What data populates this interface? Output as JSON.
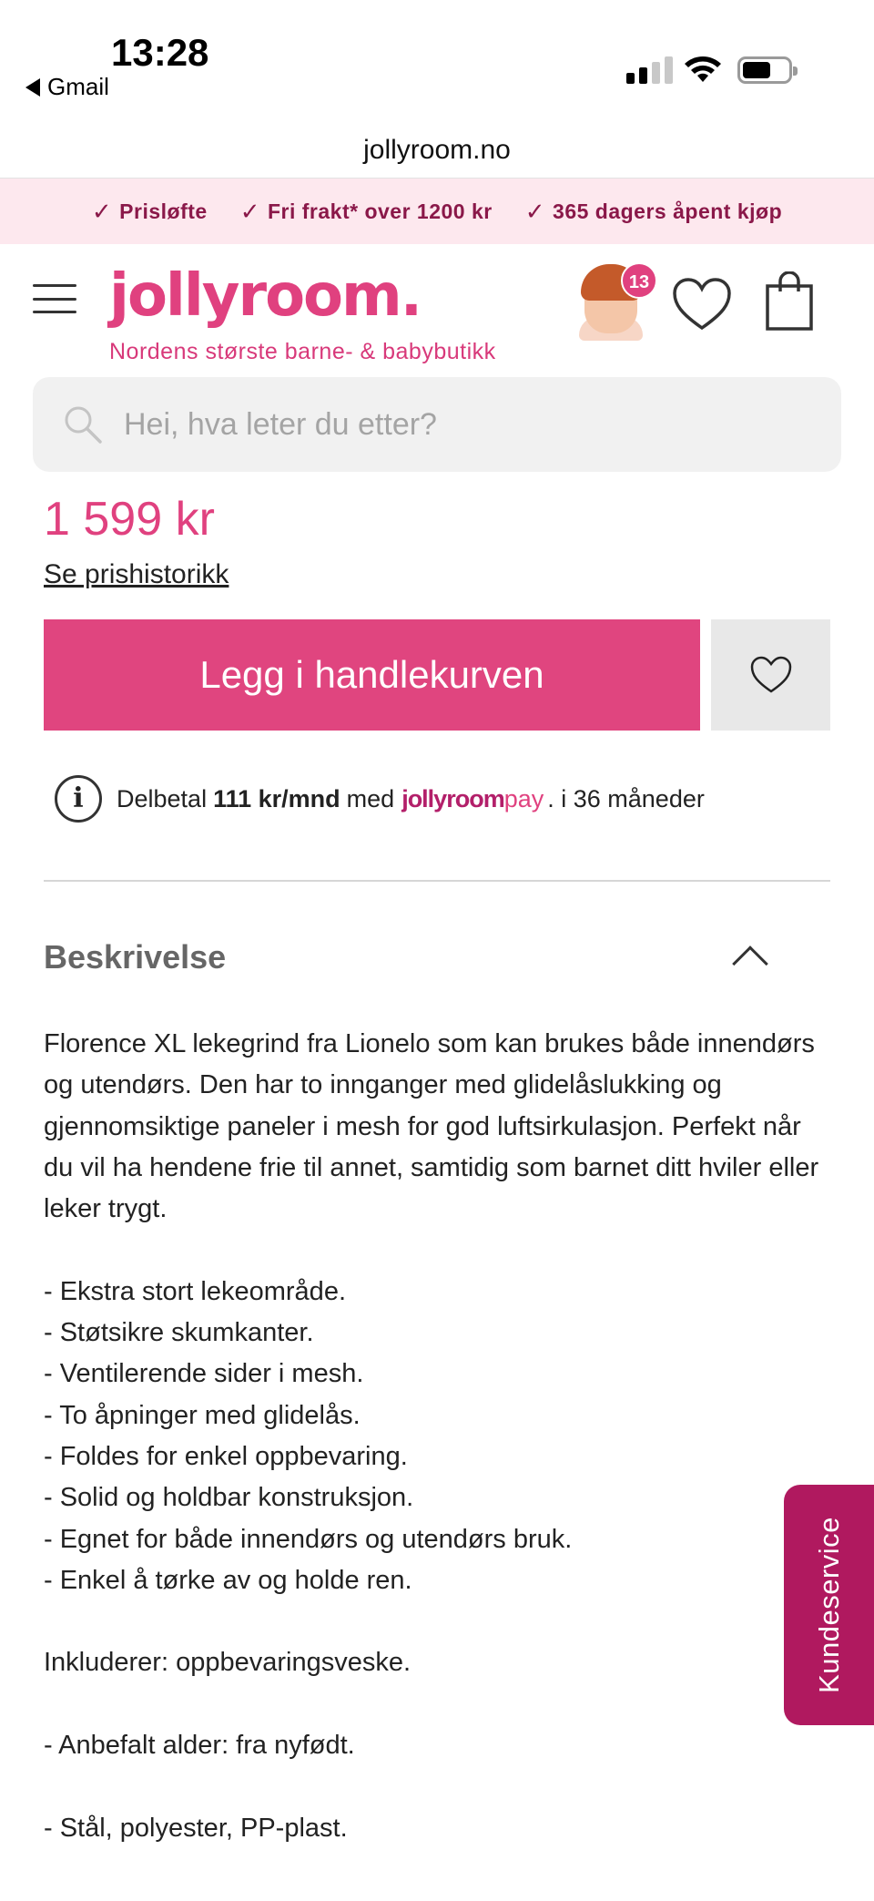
{
  "status_bar": {
    "time": "13:28",
    "back_app": "Gmail"
  },
  "browser": {
    "url": "jollyroom.no"
  },
  "usp": [
    {
      "icon": "check-icon",
      "label": "Prisløfte"
    },
    {
      "icon": "check-icon",
      "label": "Fri frakt* over 1200 kr"
    },
    {
      "icon": "check-icon",
      "label": "365 dagers åpent kjøp"
    }
  ],
  "header": {
    "logo": "jollyroom.",
    "tagline": "Nordens største barne- & babybutikk",
    "avatar_badge": "13"
  },
  "search": {
    "placeholder": "Hei, hva leter du etter?"
  },
  "product": {
    "price": "1 599 kr",
    "price_history_link": "Se prishistorikk",
    "add_to_cart_label": "Legg i handlekurven"
  },
  "installment": {
    "prefix": "Delbetal",
    "amount": "111 kr/mnd",
    "middle": "med",
    "pay_logo_main": "jollyroom",
    "pay_logo_suffix": "pay",
    "suffix": ". i 36 måneder"
  },
  "description": {
    "title": "Beskrivelse",
    "intro": "Florence XL lekegrind fra Lionelo som kan brukes både innendørs og utendørs. Den har to innganger med glidelåslukking og gjennomsiktige paneler i mesh for god luftsirkulasjon. Perfekt når du vil ha hendene frie til annet, samtidig som barnet ditt hviler eller leker trygt.",
    "features": [
      "- Ekstra stort lekeområde.",
      "- Støtsikre skumkanter.",
      "- Ventilerende sider i mesh.",
      "- To åpninger med glidelås.",
      "- Foldes for enkel oppbevaring.",
      "- Solid og holdbar konstruksjon.",
      "- Egnet for både innendørs og utendørs bruk.",
      "- Enkel å tørke av og holde ren."
    ],
    "includes": "Inkluderer: oppbevaringsveske.",
    "age": "- Anbefalt alder: fra nyfødt.",
    "material": "- Stål, polyester, PP-plast."
  },
  "customer_service": {
    "label": "Kundeservice"
  },
  "colors": {
    "brand_pink": "#e0417f",
    "brand_dark": "#b0195f",
    "usp_bg": "#fde8ee"
  }
}
